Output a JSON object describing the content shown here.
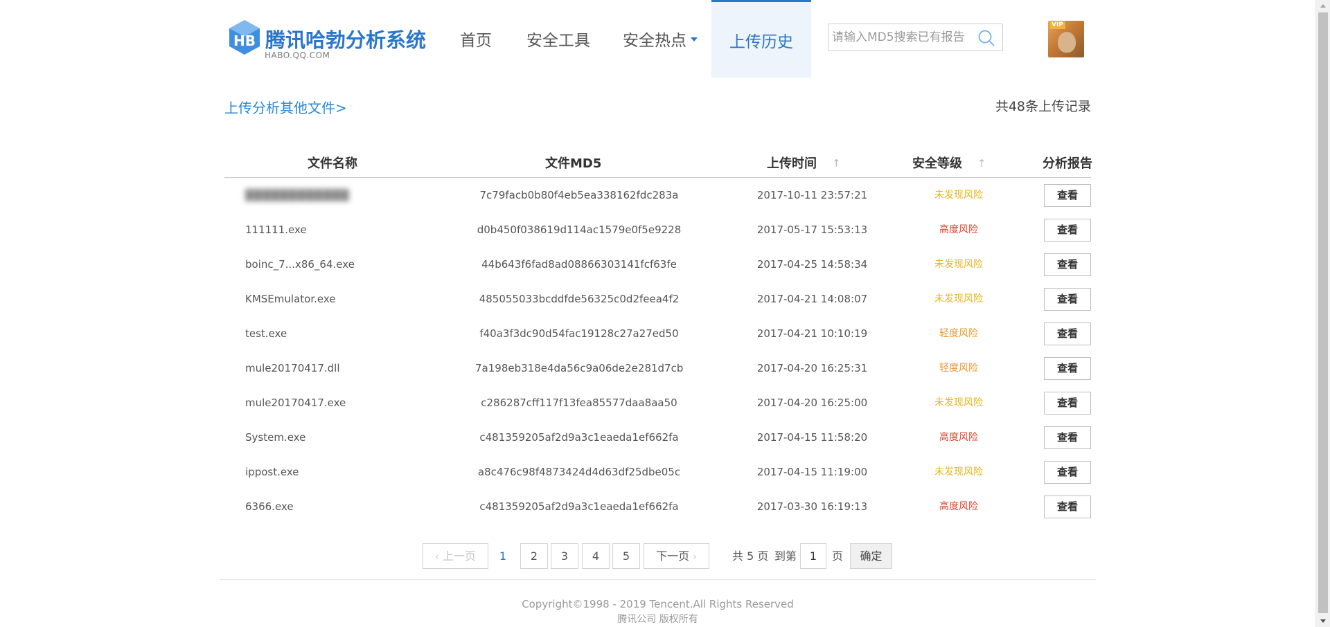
{
  "header": {
    "logo_title": "腾讯哈勃分析系统",
    "logo_subtitle": "HABO.QQ.COM",
    "nav": {
      "home": "首页",
      "tools": "安全工具",
      "hot": "安全热点",
      "upload_history": "上传历史"
    },
    "search_placeholder": "请输入MD5搜索已有报告",
    "avatar_badge": "VIP"
  },
  "colors": {
    "brand": "#2a76c9",
    "link": "#2a86d1",
    "risk_none": "#e8b421",
    "risk_high": "#d9452f",
    "risk_low": "#e89a2a"
  },
  "subheader": {
    "upload_other": "上传分析其他文件>",
    "record_count": "共48条上传记录"
  },
  "table": {
    "headers": {
      "name": "文件名称",
      "md5": "文件MD5",
      "time": "上传时间",
      "level": "安全等级",
      "report": "分析报告"
    },
    "view_label": "查看",
    "rows": [
      {
        "name": "████████████",
        "md5": "7c79facb0b80f4eb5ea338162fdc283a",
        "time": "2017-10-11 23:57:21",
        "level": "未发现风险",
        "level_type": "none"
      },
      {
        "name": "111111.exe",
        "md5": "d0b450f038619d114ac1579e0f5e9228",
        "time": "2017-05-17 15:53:13",
        "level": "高度风险",
        "level_type": "high"
      },
      {
        "name": "boinc_7...x86_64.exe",
        "md5": "44b643f6fad8ad08866303141fcf63fe",
        "time": "2017-04-25 14:58:34",
        "level": "未发现风险",
        "level_type": "none"
      },
      {
        "name": "KMSEmulator.exe",
        "md5": "485055033bcddfde56325c0d2feea4f2",
        "time": "2017-04-21 14:08:07",
        "level": "未发现风险",
        "level_type": "none"
      },
      {
        "name": "test.exe",
        "md5": "f40a3f3dc90d54fac19128c27a27ed50",
        "time": "2017-04-21 10:10:19",
        "level": "轻度风险",
        "level_type": "low"
      },
      {
        "name": "mule20170417.dll",
        "md5": "7a198eb318e4da56c9a06de2e281d7cb",
        "time": "2017-04-20 16:25:31",
        "level": "轻度风险",
        "level_type": "low"
      },
      {
        "name": "mule20170417.exe",
        "md5": "c286287cff117f13fea85577daa8aa50",
        "time": "2017-04-20 16:25:00",
        "level": "未发现风险",
        "level_type": "none"
      },
      {
        "name": "System.exe",
        "md5": "c481359205af2d9a3c1eaeda1ef662fa",
        "time": "2017-04-15 11:58:20",
        "level": "高度风险",
        "level_type": "high"
      },
      {
        "name": "ippost.exe",
        "md5": "a8c476c98f4873424d4d63df25dbe05c",
        "time": "2017-04-15 11:19:00",
        "level": "未发现风险",
        "level_type": "none"
      },
      {
        "name": "6366.exe",
        "md5": "c481359205af2d9a3c1eaeda1ef662fa",
        "time": "2017-03-30 16:19:13",
        "level": "高度风险",
        "level_type": "high"
      }
    ]
  },
  "pagination": {
    "prev": "上一页",
    "pages": [
      "1",
      "2",
      "3",
      "4",
      "5"
    ],
    "current": "1",
    "next": "下一页",
    "total": "共 5 页",
    "goto": "到第",
    "goto_value": "1",
    "page_unit": "页",
    "confirm": "确定"
  },
  "footer": {
    "copyright": "Copyright©1998 - 2019 Tencent.All Rights Reserved",
    "company": "腾讯公司 版权所有"
  }
}
